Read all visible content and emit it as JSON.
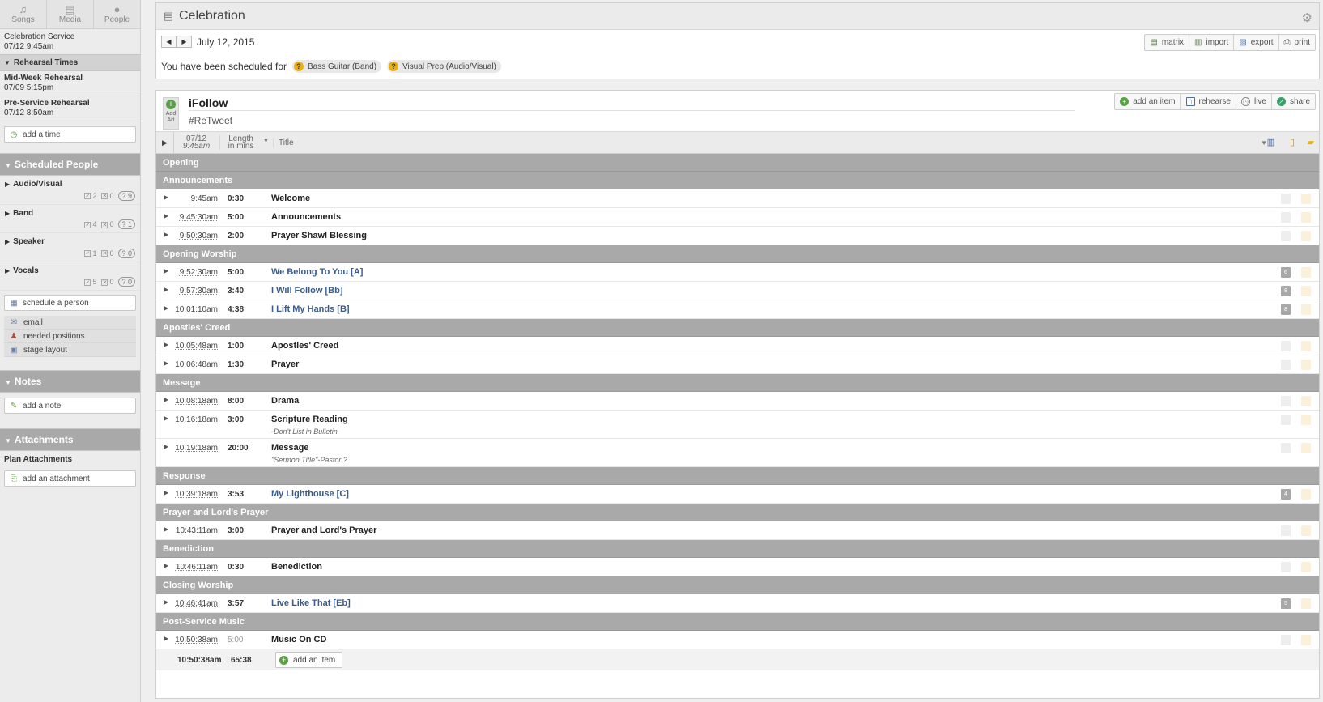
{
  "nav": [
    {
      "label": "Songs",
      "icon": "music-note-icon"
    },
    {
      "label": "Media",
      "icon": "media-icon"
    },
    {
      "label": "People",
      "icon": "person-icon"
    }
  ],
  "service": {
    "name": "Celebration Service",
    "datetime": "07/12 9:45am"
  },
  "rehearsal": {
    "heading": "Rehearsal Times",
    "items": [
      {
        "name": "Mid-Week Rehearsal",
        "datetime": "07/09 5:15pm"
      },
      {
        "name": "Pre-Service Rehearsal",
        "datetime": "07/12 8:50am"
      }
    ],
    "add_label": "add a time"
  },
  "people": {
    "heading": "Scheduled People",
    "teams": [
      {
        "name": "Audio/Visual",
        "confirmed": "2",
        "declined": "0",
        "pending": "9"
      },
      {
        "name": "Band",
        "confirmed": "4",
        "declined": "0",
        "pending": "1"
      },
      {
        "name": "Speaker",
        "confirmed": "1",
        "declined": "0",
        "pending": "0"
      },
      {
        "name": "Vocals",
        "confirmed": "5",
        "declined": "0",
        "pending": "0"
      }
    ],
    "schedule_label": "schedule a person",
    "tools": [
      {
        "label": "email",
        "icon": "envelope-icon"
      },
      {
        "label": "needed positions",
        "icon": "people-icon"
      },
      {
        "label": "stage layout",
        "icon": "layout-icon"
      }
    ]
  },
  "notes": {
    "heading": "Notes",
    "add_label": "add a note"
  },
  "attachments": {
    "heading": "Attachments",
    "sub": "Plan Attachments",
    "add_label": "add an attachment"
  },
  "header": {
    "title": "Celebration",
    "date": "July 12, 2015",
    "tools": [
      "matrix",
      "import",
      "export",
      "print"
    ],
    "scheduled_text": "You have been scheduled for",
    "positions": [
      "Bass Guitar (Band)",
      "Visual Prep (Audio/Visual)"
    ]
  },
  "plan": {
    "title": "iFollow",
    "subtitle": "#ReTweet",
    "addart": "Add Art",
    "tools": [
      "add an item",
      "rehearse",
      "live",
      "share"
    ],
    "col_date": "07/12",
    "col_time": "9:45am",
    "col_length": "Length",
    "col_length2": "in mins",
    "col_title": "Title",
    "total_time": "10:50:38am",
    "total_length": "65:38",
    "add_item_label": "add an item",
    "rows": [
      {
        "type": "header",
        "title": "Opening"
      },
      {
        "type": "header",
        "title": "Announcements"
      },
      {
        "type": "item",
        "time": "9:45am",
        "length": "0:30",
        "title": "Welcome"
      },
      {
        "type": "item",
        "time": "9:45:30am",
        "length": "5:00",
        "title": "Announcements"
      },
      {
        "type": "item",
        "time": "9:50:30am",
        "length": "2:00",
        "title": "Prayer Shawl Blessing"
      },
      {
        "type": "header",
        "title": "Opening Worship"
      },
      {
        "type": "item",
        "time": "9:52:30am",
        "length": "5:00",
        "title": "We Belong To You [A]",
        "song": true,
        "count": "6"
      },
      {
        "type": "item",
        "time": "9:57:30am",
        "length": "3:40",
        "title": "I Will Follow [Bb]",
        "song": true,
        "count": "8"
      },
      {
        "type": "item",
        "time": "10:01:10am",
        "length": "4:38",
        "title": "I Lift My Hands [B]",
        "song": true,
        "count": "8"
      },
      {
        "type": "header",
        "title": "Apostles' Creed"
      },
      {
        "type": "item",
        "time": "10:05:48am",
        "length": "1:00",
        "title": "Apostles' Creed"
      },
      {
        "type": "item",
        "time": "10:06:48am",
        "length": "1:30",
        "title": "Prayer"
      },
      {
        "type": "header",
        "title": "Message"
      },
      {
        "type": "item",
        "time": "10:08:18am",
        "length": "8:00",
        "title": "Drama"
      },
      {
        "type": "item",
        "time": "10:16:18am",
        "length": "3:00",
        "title": "Scripture Reading",
        "note": "-Don't List in Bulletin"
      },
      {
        "type": "item",
        "time": "10:19:18am",
        "length": "20:00",
        "title": "Message",
        "note": "\"Sermon Title\"-Pastor ?"
      },
      {
        "type": "header",
        "title": "Response"
      },
      {
        "type": "item",
        "time": "10:39:18am",
        "length": "3:53",
        "title": "My Lighthouse [C]",
        "song": true,
        "count": "4"
      },
      {
        "type": "header",
        "title": "Prayer and Lord's Prayer"
      },
      {
        "type": "item",
        "time": "10:43:11am",
        "length": "3:00",
        "title": "Prayer and Lord's Prayer"
      },
      {
        "type": "header",
        "title": "Benediction"
      },
      {
        "type": "item",
        "time": "10:46:11am",
        "length": "0:30",
        "title": "Benediction"
      },
      {
        "type": "header",
        "title": "Closing Worship"
      },
      {
        "type": "item",
        "time": "10:46:41am",
        "length": "3:57",
        "title": "Live Like That [Eb]",
        "song": true,
        "count": "5"
      },
      {
        "type": "header",
        "title": "Post-Service Music"
      },
      {
        "type": "item",
        "time": "10:50:38am",
        "length": "5:00",
        "title": "Music On CD",
        "muted_length": true
      }
    ]
  },
  "colors": {
    "accent_green": "#5aa045",
    "song_blue": "#3b5c8a",
    "header_gray": "#a9a9a9",
    "badge_yellow": "#e8b10f"
  }
}
